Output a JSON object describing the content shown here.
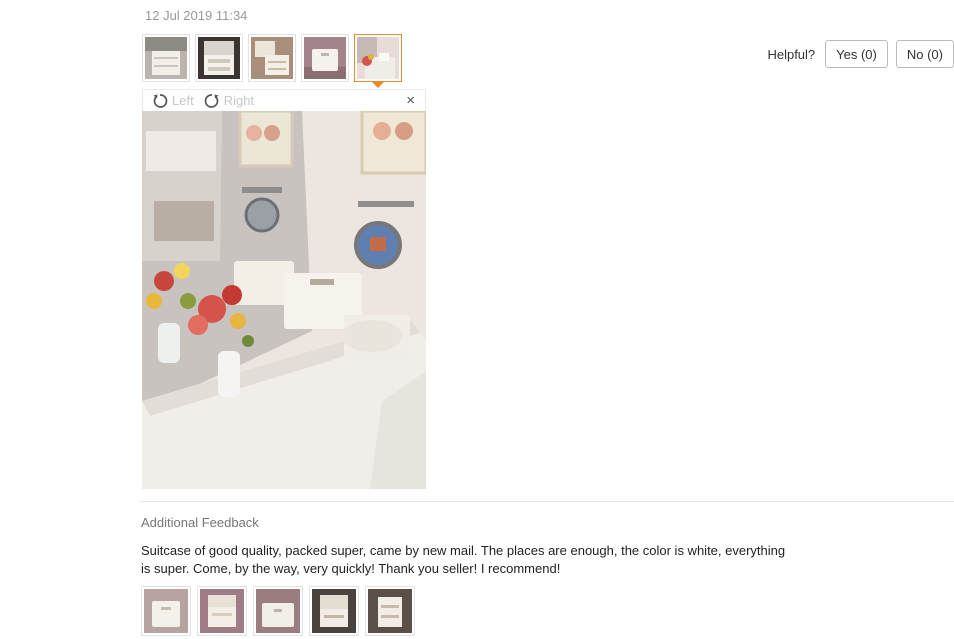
{
  "review": {
    "date": "12 Jul 2019 11:34",
    "photo_count": 5,
    "active_thumb": 5
  },
  "helpful": {
    "label": "Helpful?",
    "yes_label": "Yes (0)",
    "no_label": "No (0)"
  },
  "viewer": {
    "rotate_left_label": "Left",
    "rotate_right_label": "Right",
    "close_glyph": "×"
  },
  "additional": {
    "title": "Additional Feedback",
    "text_line1": "Suitcase of good quality, packed super, came by new mail. The places are enough, the color is white, everything",
    "text_line2": "is super. Come, by the way, very quickly! Thank you seller! I recommend!",
    "photo_count": 5
  }
}
